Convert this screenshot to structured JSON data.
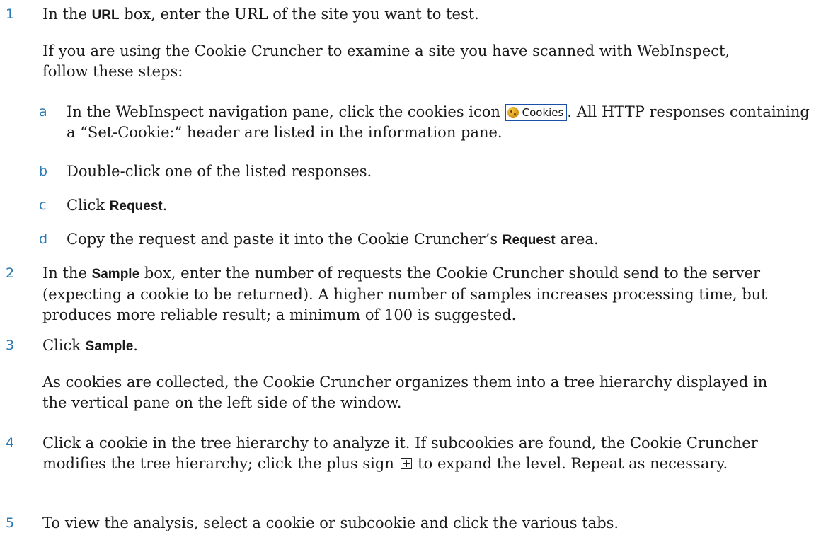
{
  "step1": {
    "num": "1",
    "before": "In the ",
    "ui": "URL",
    "after": " box, enter the URL of the site you want to test.",
    "intro": "If you are using the Cookie Cruncher to examine a site you have scanned with WebInspect, follow these steps:",
    "sub_a": {
      "letter": "a",
      "before": "In the WebInspect navigation pane, click the cookies icon ",
      "button_label": "Cookies",
      "after": ". All HTTP responses containing a “Set-Cookie:” header are listed in the information pane."
    },
    "sub_b": {
      "letter": "b",
      "text": "Double-click one of the listed responses."
    },
    "sub_c": {
      "letter": "c",
      "before": "Click ",
      "ui": "Request",
      "after": "."
    },
    "sub_d": {
      "letter": "d",
      "before": "Copy the request and paste it into the Cookie Cruncher’s ",
      "ui": "Request",
      "after": " area."
    }
  },
  "step2": {
    "num": "2",
    "before": "In the ",
    "ui": "Sample",
    "after": " box, enter the number of requests the Cookie Cruncher should send to the server (expecting a cookie to be returned). A higher number of samples increases processing time, but produces more reliable result; a minimum of 100 is suggested."
  },
  "step3": {
    "num": "3",
    "before": "Click ",
    "ui": "Sample",
    "after": ".",
    "note": "As cookies are collected, the Cookie Cruncher organizes them into a tree hierarchy displayed in the vertical pane on the left side of the window."
  },
  "step4": {
    "num": "4",
    "before": "Click a cookie in the tree hierarchy to analyze it. If subcookies are found, the Cookie Cruncher modifies the tree hierarchy; click the plus sign ",
    "after": " to expand the level. Repeat as necessary."
  },
  "step5": {
    "num": "5",
    "text": "To view the analysis, select a cookie or subcookie and click the various tabs."
  }
}
